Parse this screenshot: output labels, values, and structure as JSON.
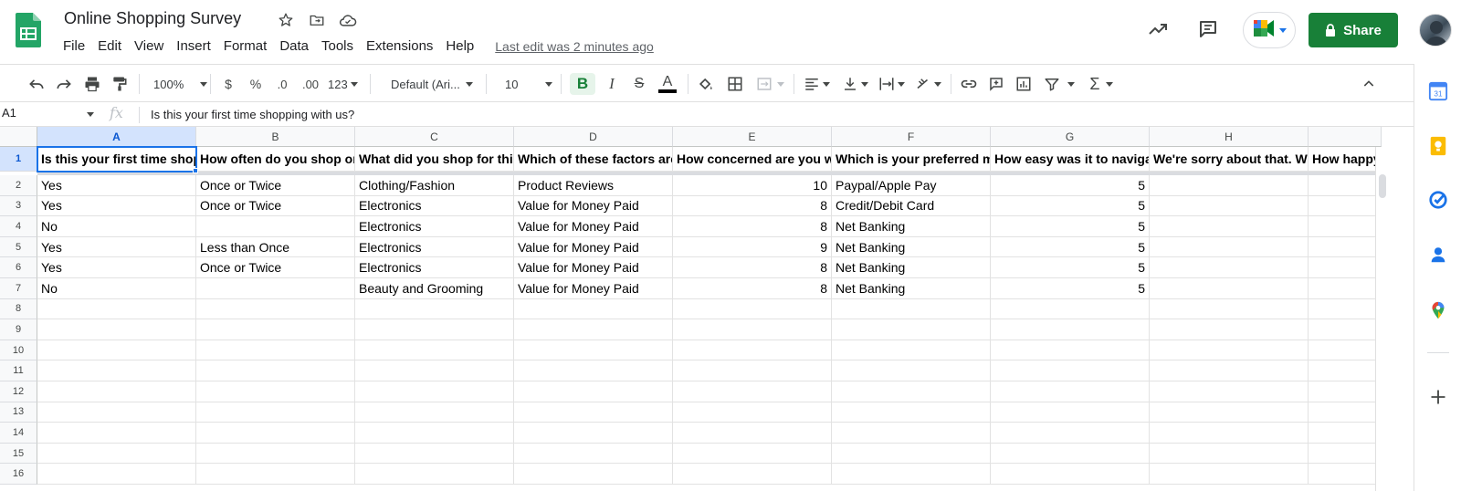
{
  "doc": {
    "title": "Online Shopping Survey",
    "last_edit": "Last edit was 2 minutes ago"
  },
  "menu": [
    "File",
    "Edit",
    "View",
    "Insert",
    "Format",
    "Data",
    "Tools",
    "Extensions",
    "Help"
  ],
  "header_right": {
    "share_label": "Share"
  },
  "toolbar": {
    "zoom": "100%",
    "currency": "$",
    "percent": "%",
    "decrease_decimal": ".0",
    "increase_decimal": ".00",
    "more_formats": "123",
    "font": "Default (Ari...",
    "font_size": "10",
    "bold": "B",
    "italic": "I",
    "strike": "S",
    "text_color": "A"
  },
  "formula_bar": {
    "cell_ref": "A1",
    "fx": "fx",
    "content": "Is this your first time shopping with us?"
  },
  "columns": [
    "A",
    "B",
    "C",
    "D",
    "E",
    "F",
    "G",
    "H",
    ""
  ],
  "rows": [
    "1",
    "2",
    "3",
    "4",
    "5",
    "6",
    "7",
    "8",
    "9",
    "10",
    "11",
    "12",
    "13",
    "14",
    "15",
    "16"
  ],
  "cells": [
    [
      "Is this your first time shopping with us?",
      "How often do you shop online?",
      "What did you shop for this time?",
      "Which of these factors are most important?",
      "How concerned are you with",
      "Which is your preferred mode of payment?",
      "How easy was it to navigate?",
      "We're sorry about that. What",
      "How happy"
    ],
    [
      "Yes",
      "Once or Twice",
      "Clothing/Fashion",
      "Product Reviews",
      "10",
      "Paypal/Apple Pay",
      "5",
      "",
      ""
    ],
    [
      "Yes",
      "Once or Twice",
      "Electronics",
      "Value for Money Paid",
      "8",
      "Credit/Debit Card",
      "5",
      "",
      ""
    ],
    [
      "No",
      "",
      "Electronics",
      "Value for Money Paid",
      "8",
      "Net Banking",
      "5",
      "",
      ""
    ],
    [
      "Yes",
      "Less than Once",
      "Electronics",
      "Value for Money Paid",
      "9",
      "Net Banking",
      "5",
      "",
      ""
    ],
    [
      "Yes",
      "Once or Twice",
      "Electronics",
      "Value for Money Paid",
      "8",
      "Net Banking",
      "5",
      "",
      ""
    ],
    [
      "No",
      "",
      "Beauty and Grooming",
      "Value for Money Paid",
      "8",
      "Net Banking",
      "5",
      "",
      ""
    ]
  ],
  "icons": {
    "star": "star-icon",
    "move": "folder-move-icon",
    "cloud": "cloud-saved-icon",
    "trend": "explore-trend-icon",
    "comments": "comments-icon",
    "meet": "meet-icon"
  },
  "colors": {
    "brand_green": "#188038",
    "selection_blue": "#1a73e8",
    "header_bg": "#f8f9fa"
  }
}
